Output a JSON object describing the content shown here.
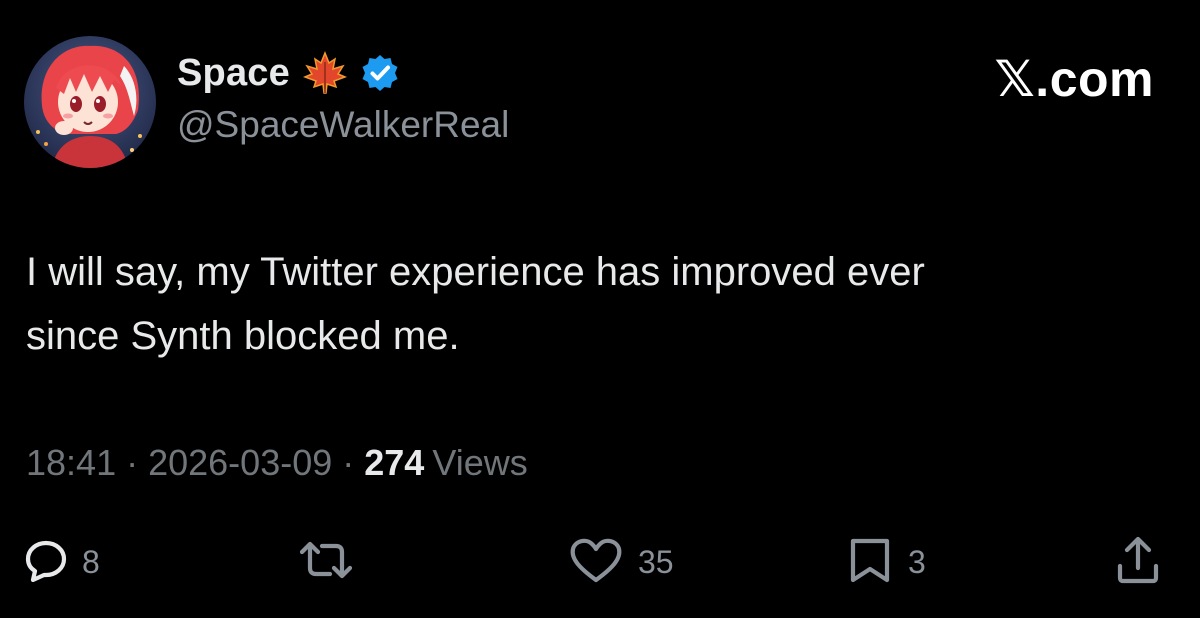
{
  "author": {
    "display_name": "Space",
    "handle": "@SpaceWalkerReal",
    "verified": true,
    "name_emoji": "maple-leaf-icon",
    "avatar": "anime-avatar-red-hair"
  },
  "brand": {
    "label": "𝕏.com"
  },
  "tweet": {
    "text_lines": [
      "I will say, my Twitter experience has improved ever",
      "since Synth blocked me."
    ]
  },
  "meta": {
    "time": "18:41",
    "separator": "·",
    "date": "2026-03-09",
    "views_count": "274",
    "views_label": "Views"
  },
  "actions": {
    "reply": {
      "icon": "reply-icon",
      "count": "8"
    },
    "repost": {
      "icon": "repost-icon",
      "count": ""
    },
    "like": {
      "icon": "heart-icon",
      "count": "35"
    },
    "bookmark": {
      "icon": "bookmark-icon",
      "count": "3"
    },
    "share": {
      "icon": "share-icon",
      "count": ""
    }
  },
  "colors": {
    "background": "#000000",
    "primary_text": "#e7e9ea",
    "secondary_text": "#71767b",
    "verified_blue": "#1d9bf0"
  }
}
